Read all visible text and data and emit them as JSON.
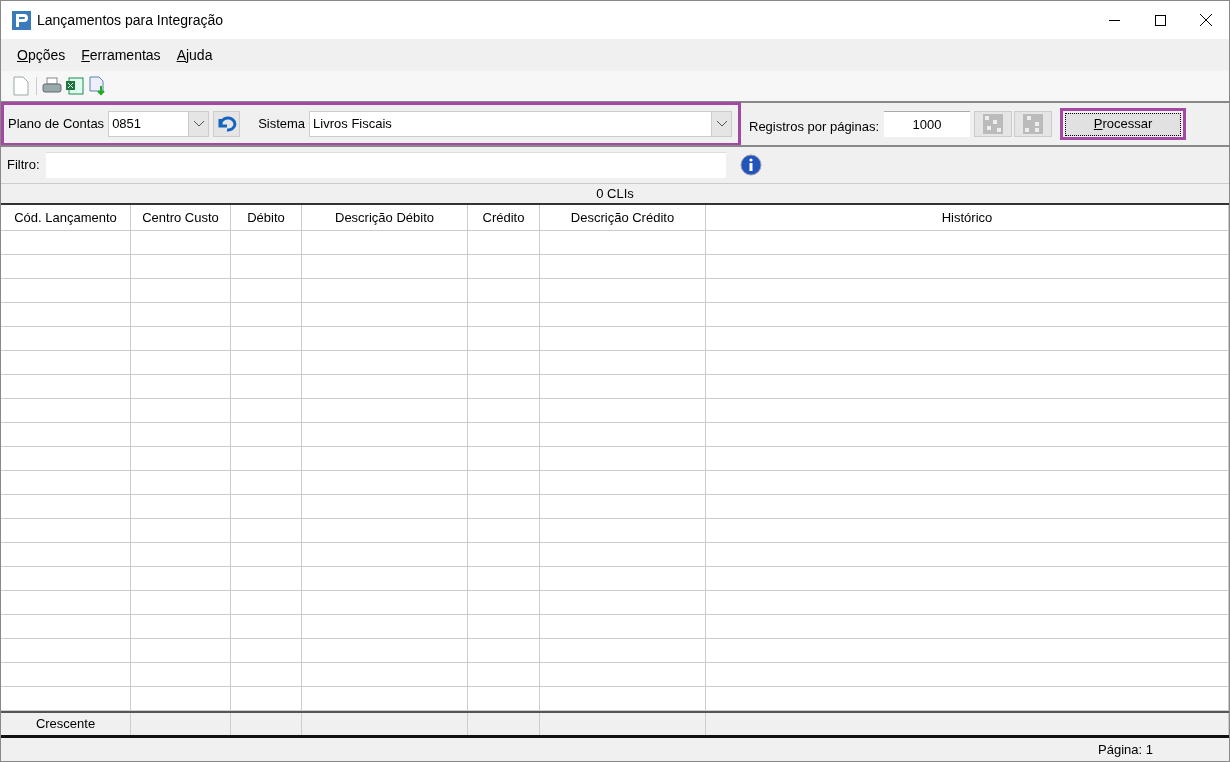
{
  "window": {
    "title": "Lançamentos para Integração"
  },
  "menu": [
    "Opções",
    "Ferramentas",
    "Ajuda"
  ],
  "params": {
    "plano_label": "Plano de Contas",
    "plano_value": "0851",
    "sistema_label": "Sistema",
    "sistema_value": "Livros Fiscais",
    "registros_label": "Registros por páginas:",
    "registros_value": "1000",
    "process_button": "Processar"
  },
  "filter": {
    "label": "Filtro:"
  },
  "grid": {
    "caption": "0 CLIs",
    "columns": [
      "Cód. Lançamento",
      "Centro Custo",
      "Débito",
      "Descrição Débito",
      "Crédito",
      "Descrição Crédito",
      "Histórico"
    ],
    "footer": [
      "Crescente"
    ]
  },
  "status_bar": {
    "page": "Página: 1"
  }
}
